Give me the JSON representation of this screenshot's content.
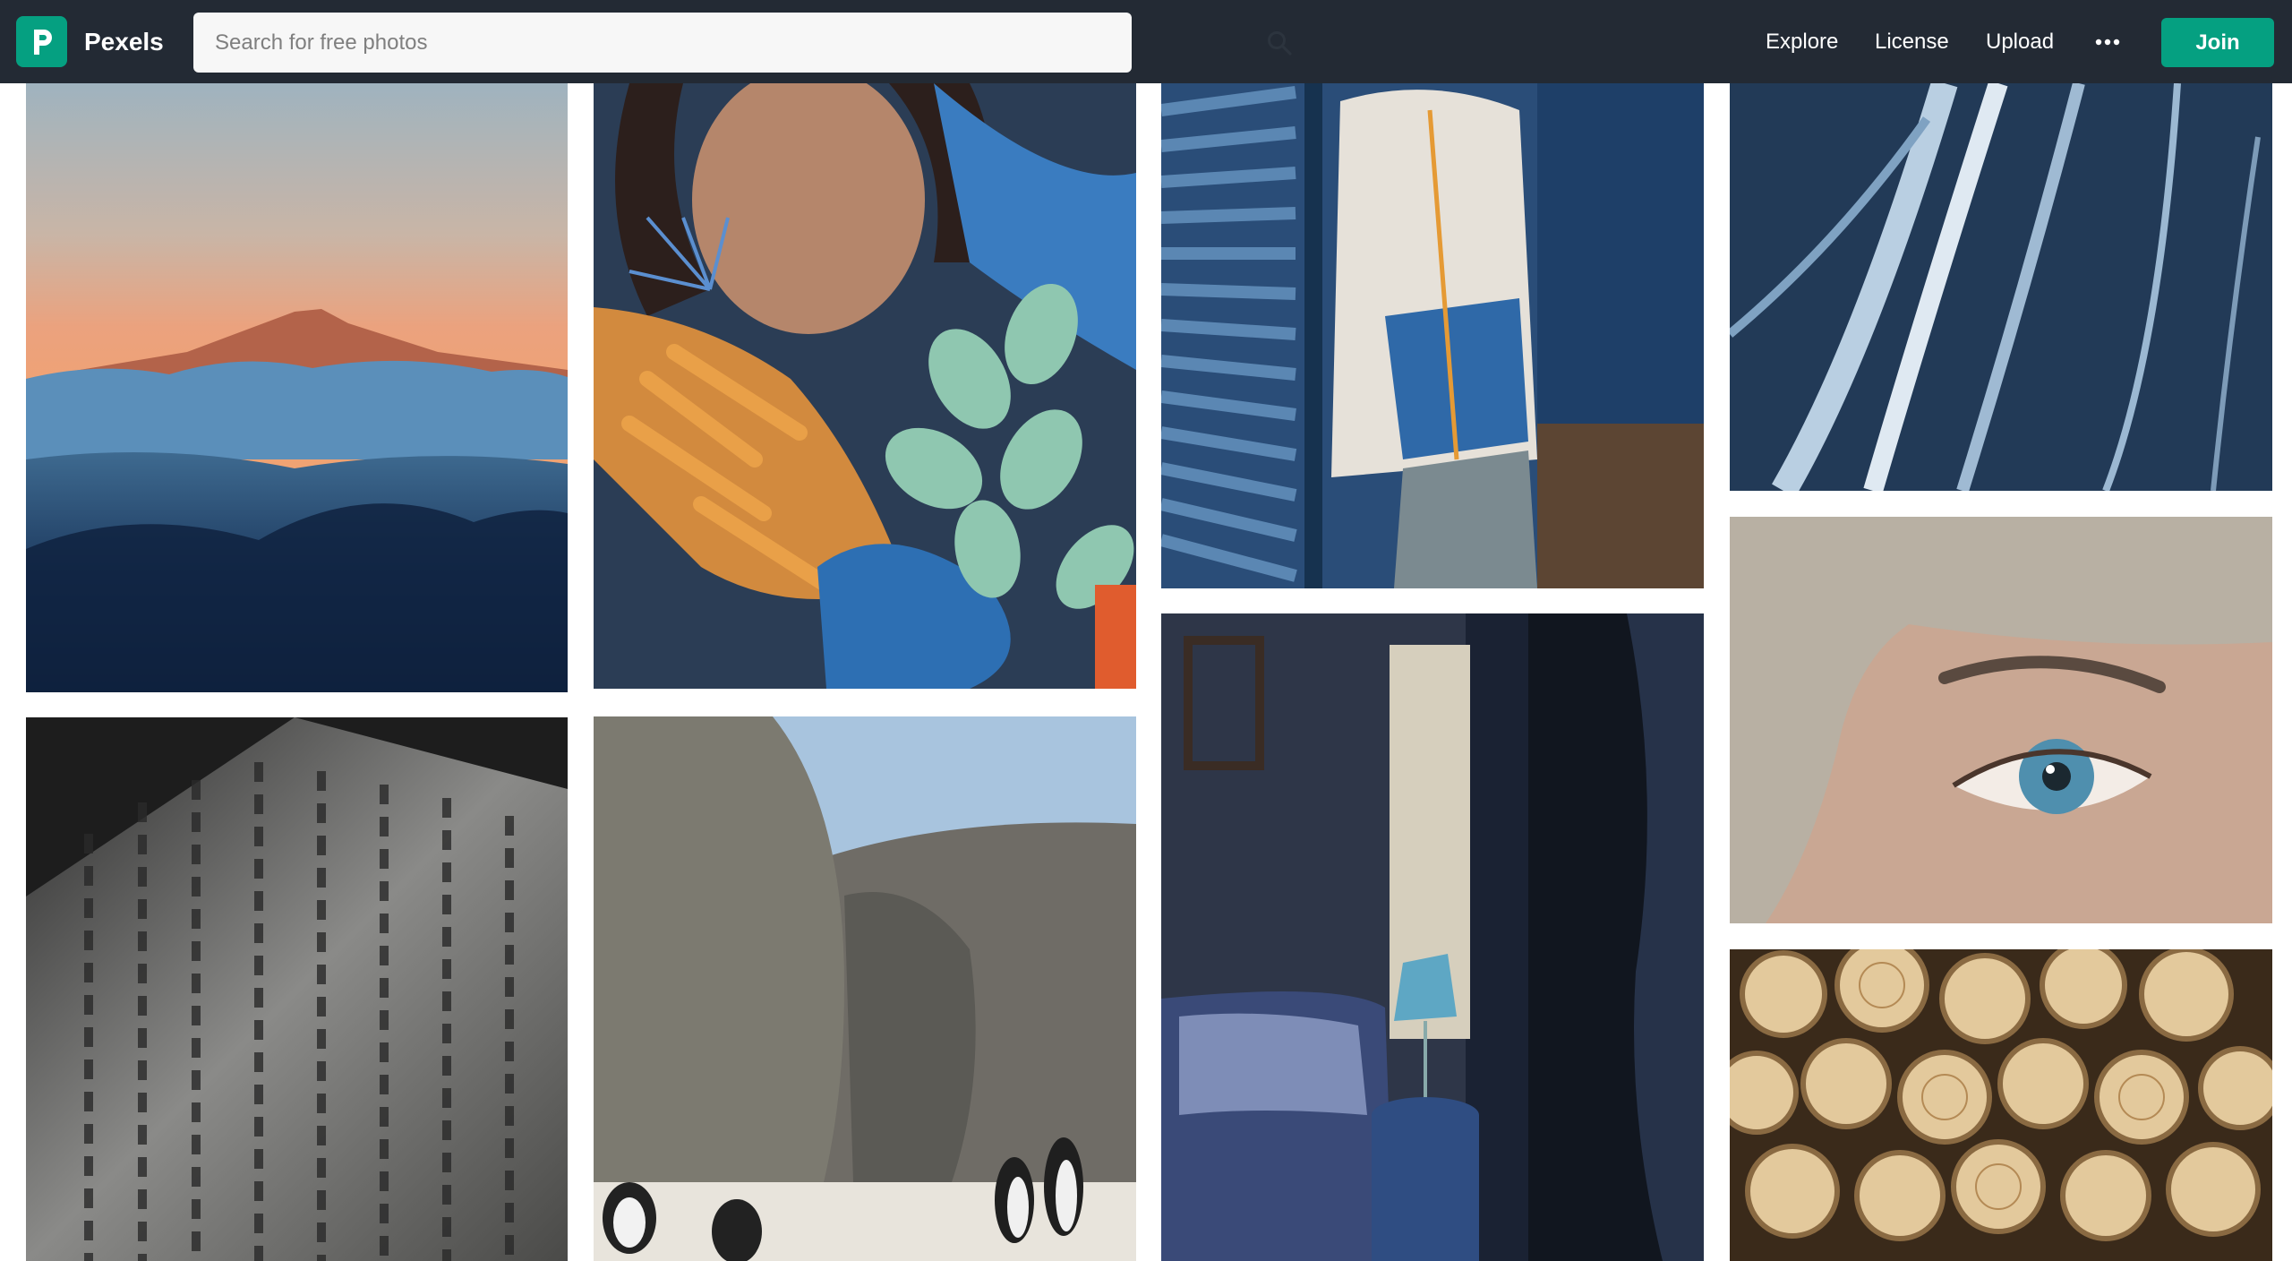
{
  "brand": {
    "name": "Pexels",
    "logo_letter": "P",
    "color": "#05a081"
  },
  "header": {
    "background": "#232a34"
  },
  "search": {
    "placeholder": "Search for free photos",
    "value": "",
    "icon": "search-icon"
  },
  "nav": {
    "explore": "Explore",
    "license": "License",
    "upload": "Upload",
    "more_icon": "ellipsis-icon",
    "join": "Join"
  },
  "photos": [
    {
      "subject": "mountain peak above clouds at sunset"
    },
    {
      "subject": "woman with blue and orange leaves"
    },
    {
      "subject": "person in fleece jacket by blue wall"
    },
    {
      "subject": "frozen ice cracks"
    },
    {
      "subject": "eye close-up"
    },
    {
      "subject": "carved temple inscriptions"
    },
    {
      "subject": "penguins among boulders"
    },
    {
      "subject": "dark bedroom with lamp"
    },
    {
      "subject": "stacked cut logs"
    }
  ]
}
